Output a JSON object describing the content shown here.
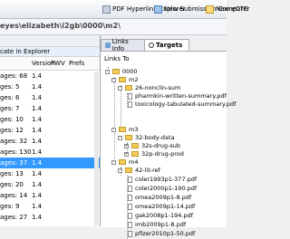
{
  "toolbar": {
    "btn1": "PDF Hyperlink Explorer",
    "btn2": "New Submission Comparer",
    "btn3": "New eCTD"
  },
  "path": "eyes\\elizabeth\\i2gb\\0000\\m2\\",
  "left": {
    "header": "cate in Explorer",
    "col_file": "",
    "col_version": "Version",
    "col_fwv": "FWV",
    "col_prefs": "Prefs",
    "rows": [
      {
        "label": "ages: 68",
        "version": "1.4"
      },
      {
        "label": "ges: 5",
        "version": "1.4"
      },
      {
        "label": "ges: 6",
        "version": "1.4"
      },
      {
        "label": "ges: 7",
        "version": "1.4"
      },
      {
        "label": "ges: 10",
        "version": "1.4"
      },
      {
        "label": "ges: 12",
        "version": "1.4"
      },
      {
        "label": "ages: 32",
        "version": "1.4"
      },
      {
        "label": "ages: 130",
        "version": "1.4"
      },
      {
        "label": "ages: 37",
        "version": "1.4",
        "selected": true
      },
      {
        "label": "ges: 13",
        "version": "1.4"
      },
      {
        "label": "ges: 20",
        "version": "1.4"
      },
      {
        "label": "ages: 14",
        "version": "1.4"
      },
      {
        "label": "ges: 9",
        "version": "1.4"
      },
      {
        "label": "ages: 27",
        "version": "1.4"
      }
    ]
  },
  "right": {
    "tab1": "Links Info",
    "tab2": "Targets",
    "links_to": "Links To",
    "tree": {
      "root": "0000",
      "m2": "m2",
      "n26": "26-nonclin-sum",
      "f1": "pharmkin-written-summary.pdf",
      "f2": "toxicology-tabulated-summary.pdf",
      "m3": "m3",
      "n32": "32-body-data",
      "n32s": "32s-drug-sub",
      "n32p": "32p-drug-prod",
      "m4": "m4",
      "n42": "42-lit-ref",
      "g1": "coler1993p1-377.pdf",
      "g2": "coler2000p1-190.pdf",
      "g3": "omea2009p1-8.pdf",
      "g4": "omea2009p1-14.pdf",
      "g5": "gak2008p1-194.pdf",
      "g6": "imb2009p1-8.pdf",
      "g7": "pfizer2010p1-50.pdf"
    }
  }
}
